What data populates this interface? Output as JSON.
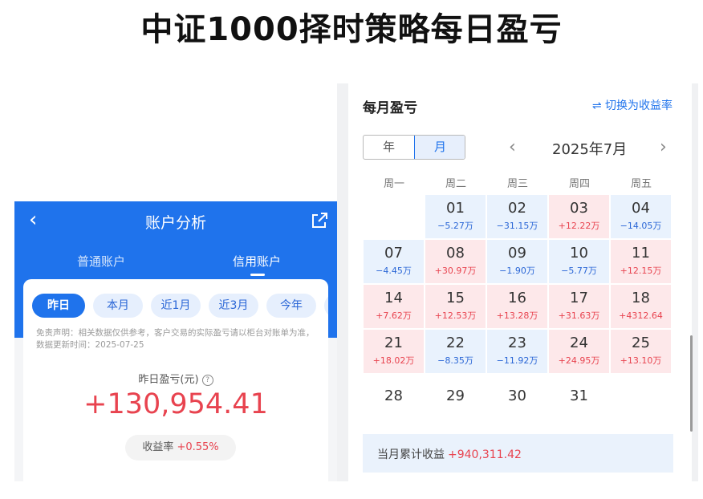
{
  "page_title": "中证1000择时策略每日盈亏",
  "left_panel": {
    "nav": {
      "back_icon": "chevron-left-icon",
      "title": "账户分析",
      "share_icon": "share-icon"
    },
    "account_tabs": [
      "普通账户",
      "信用账户"
    ],
    "active_account_tab": "信用账户",
    "period_pills": [
      "昨日",
      "本月",
      "近1月",
      "近3月",
      "今年"
    ],
    "active_period": "昨日",
    "disclaimer": "免责声明：相关数据仅供参考，客户交易的实际盈亏请以柜台对账单为准，数据更新时间：2025-07-25",
    "yesterday_label": "昨日盈亏(元)",
    "help_icon": "?",
    "yesterday_value": "+130,954.41",
    "rate_label": "收益率",
    "rate_value": "+0.55%"
  },
  "right_panel": {
    "title": "每月盈亏",
    "switch_label": "⇌ 切换为收益率",
    "view_modes": [
      "年",
      "月"
    ],
    "active_view": "月",
    "prev_icon": "‹",
    "next_icon": "›",
    "month_label": "2025年7月",
    "weekdays": [
      "周一",
      "周二",
      "周三",
      "周四",
      "周五"
    ],
    "days": [
      {
        "day": "01",
        "amount": "−5.27万",
        "type": "loss"
      },
      {
        "day": "02",
        "amount": "−31.15万",
        "type": "loss"
      },
      {
        "day": "03",
        "amount": "+12.22万",
        "type": "gain"
      },
      {
        "day": "04",
        "amount": "−14.05万",
        "type": "loss"
      },
      {
        "day": "07",
        "amount": "−4.45万",
        "type": "loss"
      },
      {
        "day": "08",
        "amount": "+30.97万",
        "type": "gain"
      },
      {
        "day": "09",
        "amount": "−1.90万",
        "type": "loss"
      },
      {
        "day": "10",
        "amount": "−5.77万",
        "type": "loss"
      },
      {
        "day": "11",
        "amount": "+12.15万",
        "type": "gain"
      },
      {
        "day": "14",
        "amount": "+7.62万",
        "type": "gain"
      },
      {
        "day": "15",
        "amount": "+12.53万",
        "type": "gain"
      },
      {
        "day": "16",
        "amount": "+13.28万",
        "type": "gain"
      },
      {
        "day": "17",
        "amount": "+31.63万",
        "type": "gain"
      },
      {
        "day": "18",
        "amount": "+4312.64",
        "type": "gain"
      },
      {
        "day": "21",
        "amount": "+18.02万",
        "type": "gain"
      },
      {
        "day": "22",
        "amount": "−8.35万",
        "type": "loss"
      },
      {
        "day": "23",
        "amount": "−11.92万",
        "type": "loss"
      },
      {
        "day": "24",
        "amount": "+24.95万",
        "type": "gain"
      },
      {
        "day": "25",
        "amount": "+13.10万",
        "type": "gain"
      },
      {
        "day": "28",
        "amount": "",
        "type": "plain"
      },
      {
        "day": "29",
        "amount": "",
        "type": "plain"
      },
      {
        "day": "30",
        "amount": "",
        "type": "plain"
      },
      {
        "day": "31",
        "amount": "",
        "type": "plain"
      }
    ],
    "summary_label": "当月累计收益",
    "summary_value": "+940,311.42"
  },
  "colors": {
    "brand_blue": "#1f73ec",
    "gain_red": "#e8434f",
    "loss_blue": "#2a66d6",
    "gain_bg": "#fde8ea",
    "loss_bg": "#e9f2fd"
  }
}
